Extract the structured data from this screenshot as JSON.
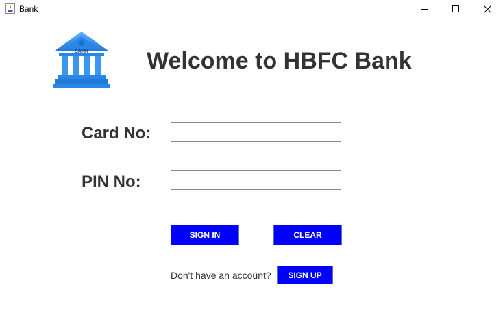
{
  "window": {
    "title": "Bank",
    "icon": "java-coffee-icon",
    "controls": [
      "minimize-icon",
      "maximize-icon",
      "close-icon"
    ]
  },
  "header": {
    "logo_icon": "bank-building-icon",
    "logo_text": "BANK",
    "welcome": "Welcome to HBFC Bank"
  },
  "form": {
    "card_label": "Card No:",
    "card_value": "",
    "pin_label": "PIN No:",
    "pin_value": ""
  },
  "buttons": {
    "sign_in": "SIGN IN",
    "clear": "CLEAR",
    "sign_up": "SIGN UP"
  },
  "signup_prompt": "Don't have an account?",
  "colors": {
    "button_bg": "#0000ff",
    "button_text": "#ffffff",
    "label_text": "#333333",
    "logo_blue": "#2f8fea"
  }
}
